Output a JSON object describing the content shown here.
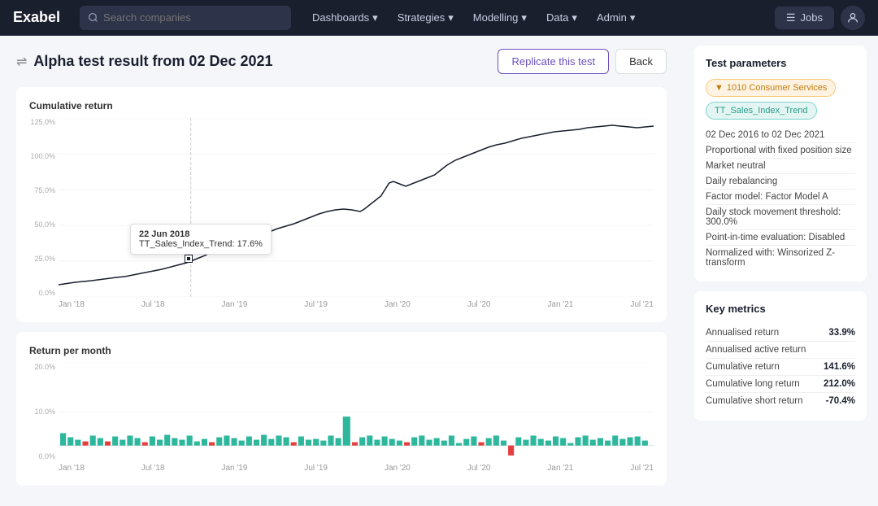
{
  "navbar": {
    "logo": "Exabel",
    "search_placeholder": "Search companies",
    "nav_items": [
      {
        "label": "Dashboards",
        "has_arrow": true
      },
      {
        "label": "Strategies",
        "has_arrow": true
      },
      {
        "label": "Modelling",
        "has_arrow": true
      },
      {
        "label": "Data",
        "has_arrow": true
      },
      {
        "label": "Admin",
        "has_arrow": true
      }
    ],
    "jobs_label": "Jobs"
  },
  "page": {
    "title": "Alpha test result from 02 Dec 2021",
    "replicate_label": "Replicate this test",
    "back_label": "Back"
  },
  "cumulative_chart": {
    "title": "Cumulative return",
    "tooltip_date": "22 Jun 2018",
    "tooltip_value": "TT_Sales_Index_Trend: 17.6%",
    "x_labels": [
      "Jan '18",
      "Jul '18",
      "Jan '19",
      "Jul '19",
      "Jan '20",
      "Jul '20",
      "Jan '21",
      "Jul '21"
    ],
    "y_labels": [
      "125.0%",
      "100.0%",
      "75.0%",
      "50.0%",
      "25.0%",
      "0.0%"
    ]
  },
  "monthly_chart": {
    "title": "Return per month",
    "x_labels": [
      "Jan '18",
      "Jul '18",
      "Jan '19",
      "Jul '19",
      "Jan '20",
      "Jul '20",
      "Jan '21",
      "Jul '21"
    ],
    "y_labels": [
      "20.0%",
      "10.0%",
      "0.0%"
    ]
  },
  "test_parameters": {
    "title": "Test parameters",
    "tags": [
      {
        "label": "1010 Consumer Services",
        "type": "orange",
        "icon": "▼"
      },
      {
        "label": "TT_Sales_Index_Trend",
        "type": "teal"
      }
    ],
    "params": [
      "02 Dec 2016 to 02 Dec 2021",
      "Proportional with fixed position size",
      "Market neutral",
      "Daily rebalancing",
      "Factor model: Factor Model A",
      "Daily stock movement threshold: 300.0%",
      "Point-in-time evaluation: Disabled",
      "Normalized with: Winsorized Z-transform"
    ]
  },
  "key_metrics": {
    "title": "Key metrics",
    "metrics": [
      {
        "label": "Annualised return",
        "value": "33.9%"
      },
      {
        "label": "Annualised active return",
        "value": ""
      },
      {
        "label": "Cumulative return",
        "value": "141.6%"
      },
      {
        "label": "Cumulative long return",
        "value": "212.0%"
      },
      {
        "label": "Cumulative short return",
        "value": "-70.4%"
      }
    ]
  }
}
